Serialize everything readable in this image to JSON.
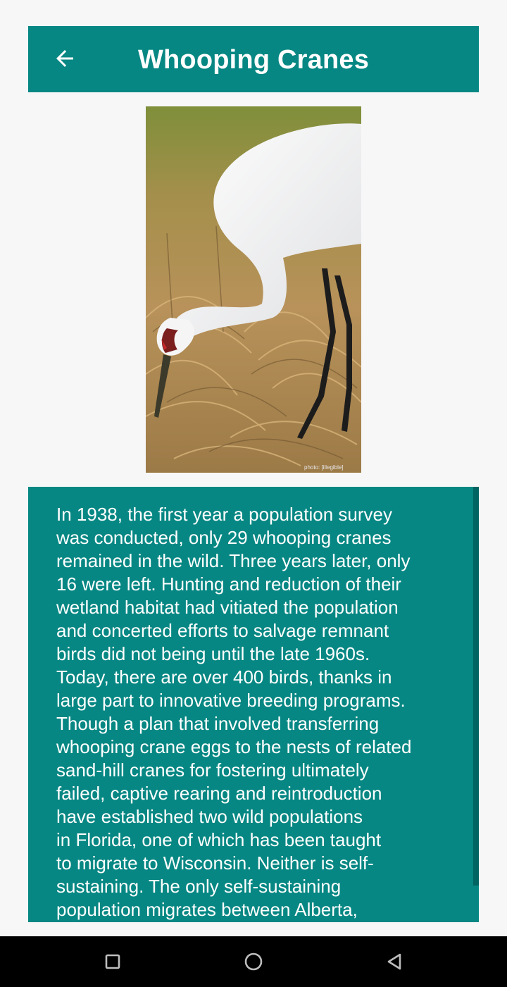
{
  "app_bar": {
    "title": "Whooping Cranes",
    "back_icon": "arrow-back-icon",
    "background": "#068783"
  },
  "article": {
    "image_alt": "Whooping crane foraging in dry grass",
    "image_credit": "photo: [illegible]",
    "body": "In 1938, the first year a population survey\nwas conducted, only 29 whooping cranes\nremained in the wild. Three years later, only\n16 were left. Hunting and reduction of their\nwetland habitat had vitiated the population\nand concerted efforts to salvage remnant\nbirds did not being until the late 1960s.\nToday, there are over 400 birds, thanks in\nlarge part to innovative breeding programs.\nThough a plan that involved transferring\nwhooping crane eggs to the nests of related\nsand-hill cranes for fostering ultimately\nfailed, captive rearing and reintroduction\nhave established two wild populations\nin Florida, one of which has been taught\nto migrate to Wisconsin. Neither is self-\nsustaining. The only self-sustaining\npopulation migrates between Alberta,"
  },
  "nav": {
    "recents_icon": "square-recents-icon",
    "home_icon": "circle-home-icon",
    "back_icon": "triangle-back-icon"
  }
}
